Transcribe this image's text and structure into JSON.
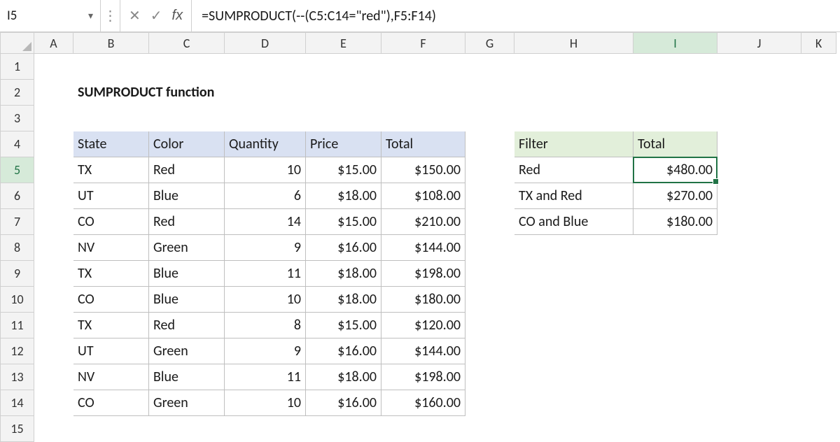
{
  "name_box": "I5",
  "formula": "=SUMPRODUCT(--(C5:C14=\"red\"),F5:F14)",
  "columns": [
    "A",
    "B",
    "C",
    "D",
    "E",
    "F",
    "G",
    "H",
    "I",
    "J",
    "K"
  ],
  "rows": [
    1,
    2,
    3,
    4,
    5,
    6,
    7,
    8,
    9,
    10,
    11,
    12,
    13,
    14,
    15
  ],
  "title": "SUMPRODUCT function",
  "main_headers": {
    "state": "State",
    "color": "Color",
    "quantity": "Quantity",
    "price": "Price",
    "total": "Total"
  },
  "side_headers": {
    "filter": "Filter",
    "total": "Total"
  },
  "main_rows": [
    {
      "state": "TX",
      "color": "Red",
      "qty": "10",
      "price": "$15.00",
      "total": "$150.00"
    },
    {
      "state": "UT",
      "color": "Blue",
      "qty": "6",
      "price": "$18.00",
      "total": "$108.00"
    },
    {
      "state": "CO",
      "color": "Red",
      "qty": "14",
      "price": "$15.00",
      "total": "$210.00"
    },
    {
      "state": "NV",
      "color": "Green",
      "qty": "9",
      "price": "$16.00",
      "total": "$144.00"
    },
    {
      "state": "TX",
      "color": "Blue",
      "qty": "11",
      "price": "$18.00",
      "total": "$198.00"
    },
    {
      "state": "CO",
      "color": "Blue",
      "qty": "10",
      "price": "$18.00",
      "total": "$180.00"
    },
    {
      "state": "TX",
      "color": "Red",
      "qty": "8",
      "price": "$15.00",
      "total": "$120.00"
    },
    {
      "state": "UT",
      "color": "Green",
      "qty": "9",
      "price": "$16.00",
      "total": "$144.00"
    },
    {
      "state": "NV",
      "color": "Blue",
      "qty": "11",
      "price": "$18.00",
      "total": "$198.00"
    },
    {
      "state": "CO",
      "color": "Green",
      "qty": "10",
      "price": "$16.00",
      "total": "$160.00"
    }
  ],
  "side_rows": [
    {
      "filter": "Red",
      "total": "$480.00"
    },
    {
      "filter": "TX and Red",
      "total": "$270.00"
    },
    {
      "filter": "CO and Blue",
      "total": "$180.00"
    }
  ],
  "active_cell": "I5",
  "chart_data": {
    "type": "table",
    "title": "SUMPRODUCT function",
    "main_table": {
      "columns": [
        "State",
        "Color",
        "Quantity",
        "Price",
        "Total"
      ],
      "rows": [
        [
          "TX",
          "Red",
          10,
          15.0,
          150.0
        ],
        [
          "UT",
          "Blue",
          6,
          18.0,
          108.0
        ],
        [
          "CO",
          "Red",
          14,
          15.0,
          210.0
        ],
        [
          "NV",
          "Green",
          9,
          16.0,
          144.0
        ],
        [
          "TX",
          "Blue",
          11,
          18.0,
          198.0
        ],
        [
          "CO",
          "Blue",
          10,
          18.0,
          180.0
        ],
        [
          "TX",
          "Red",
          8,
          15.0,
          120.0
        ],
        [
          "UT",
          "Green",
          9,
          16.0,
          144.0
        ],
        [
          "NV",
          "Blue",
          11,
          18.0,
          198.0
        ],
        [
          "CO",
          "Green",
          10,
          16.0,
          160.0
        ]
      ]
    },
    "summary_table": {
      "columns": [
        "Filter",
        "Total"
      ],
      "rows": [
        [
          "Red",
          480.0
        ],
        [
          "TX and Red",
          270.0
        ],
        [
          "CO and Blue",
          180.0
        ]
      ]
    }
  }
}
